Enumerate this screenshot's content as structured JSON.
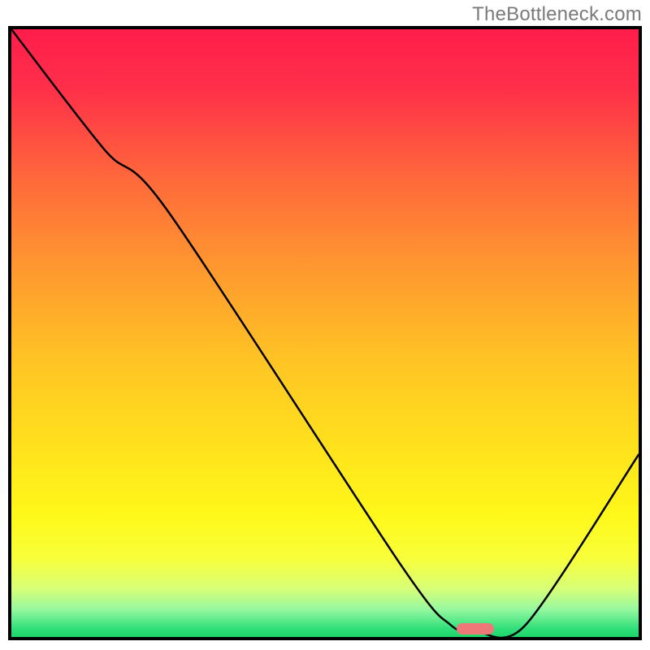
{
  "watermark": "TheBottleneck.com",
  "chart_data": {
    "type": "line",
    "title": "",
    "xlabel": "",
    "ylabel": "",
    "xlim": [
      0,
      100
    ],
    "ylim": [
      0,
      100
    ],
    "grid": false,
    "legend": false,
    "series": [
      {
        "name": "curve",
        "x": [
          0,
          15,
          25,
          62,
          70,
          74,
          82,
          100
        ],
        "y": [
          100,
          80,
          70,
          12,
          2,
          1,
          2,
          30
        ]
      }
    ],
    "marker": {
      "x": 74,
      "y": 1.3,
      "color": "#ee7877",
      "width_pct": 6
    },
    "background_gradient": {
      "stops": [
        {
          "offset": 0.0,
          "color": "#ff1d4b"
        },
        {
          "offset": 0.1,
          "color": "#ff3049"
        },
        {
          "offset": 0.25,
          "color": "#ff6a3b"
        },
        {
          "offset": 0.4,
          "color": "#ff9a2f"
        },
        {
          "offset": 0.55,
          "color": "#ffc524"
        },
        {
          "offset": 0.7,
          "color": "#ffe41c"
        },
        {
          "offset": 0.8,
          "color": "#fff81a"
        },
        {
          "offset": 0.87,
          "color": "#f8ff3a"
        },
        {
          "offset": 0.92,
          "color": "#d8ff77"
        },
        {
          "offset": 0.955,
          "color": "#95f8a0"
        },
        {
          "offset": 0.985,
          "color": "#34e07b"
        },
        {
          "offset": 1.0,
          "color": "#1ad66a"
        }
      ]
    }
  }
}
